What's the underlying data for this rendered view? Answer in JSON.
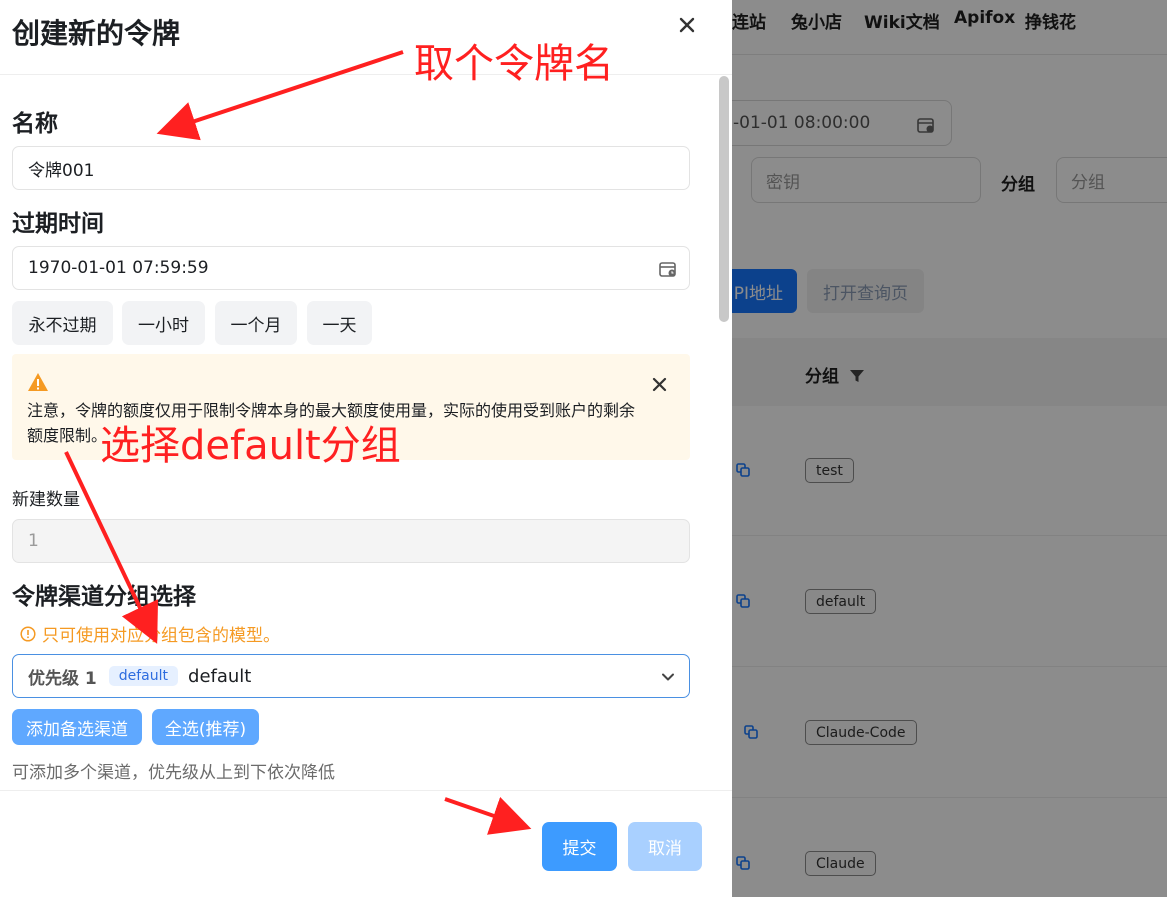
{
  "background": {
    "nav_items": [
      "连站",
      "兔小店",
      "Wiki文档",
      "Apifox",
      "挣钱花"
    ],
    "datetime_value": "-01-01 08:00:00",
    "key_placeholder": "密钥",
    "group_label": "分组",
    "group_placeholder": "分组",
    "api_button": "PI地址",
    "query_button": "打开查询页",
    "group_column_header": "分组",
    "group_tags": [
      "test",
      "default",
      "Claude-Code",
      "Claude"
    ]
  },
  "sheet": {
    "title": "创建新的令牌",
    "name_label": "名称",
    "name_value": "令牌001",
    "expire_label": "过期时间",
    "expire_value": "1970-01-01 07:59:59",
    "quick_buttons": [
      "永不过期",
      "一小时",
      "一个月",
      "一天"
    ],
    "warning_text": "注意，令牌的额度仅用于限制令牌本身的最大额度使用量，实际的使用受到账户的剩余额度限制。",
    "count_label": "新建数量",
    "count_value": "1",
    "channel_label": "令牌渠道分组选择",
    "channel_hint": "只可使用对应分组包含的模型。",
    "priority_label": "优先级 1",
    "selected_chip": "default",
    "selected_value": "default",
    "add_channel_button": "添加备选渠道",
    "select_all_button": "全选(推荐)",
    "multi_hint": "可添加多个渠道，优先级从上到下依次降低",
    "submit_button": "提交",
    "cancel_button": "取消"
  },
  "annotations": {
    "name_note": "取个令牌名",
    "group_note": "选择default分组"
  },
  "colors": {
    "primary": "#3d9bff",
    "annotation": "#ff2020",
    "warning_bg": "#fff8ea",
    "hint_orange": "#f59a23"
  }
}
